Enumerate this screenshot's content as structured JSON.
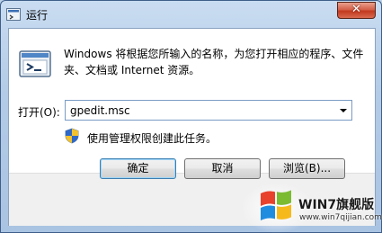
{
  "window": {
    "title": "运行",
    "close_symbol": "✕"
  },
  "content": {
    "description": "Windows 将根据您所输入的名称，为您打开相应的程序、文件夹、文档或 Internet 资源。",
    "open_label": "打开(O):",
    "open_value": "gpedit.msc",
    "admin_note": "使用管理权限创建此任务。"
  },
  "buttons": {
    "ok": "确定",
    "cancel": "取消",
    "browse": "浏览(B)..."
  },
  "watermark": {
    "text": "WIN7旗舰版",
    "url": "www.win7qijian.com"
  },
  "icons": {
    "title": "run-icon",
    "main": "run-program-icon",
    "admin": "uac-shield-icon",
    "dropdown": "chevron-down-icon",
    "watermark_logo": "windows-logo-icon"
  }
}
